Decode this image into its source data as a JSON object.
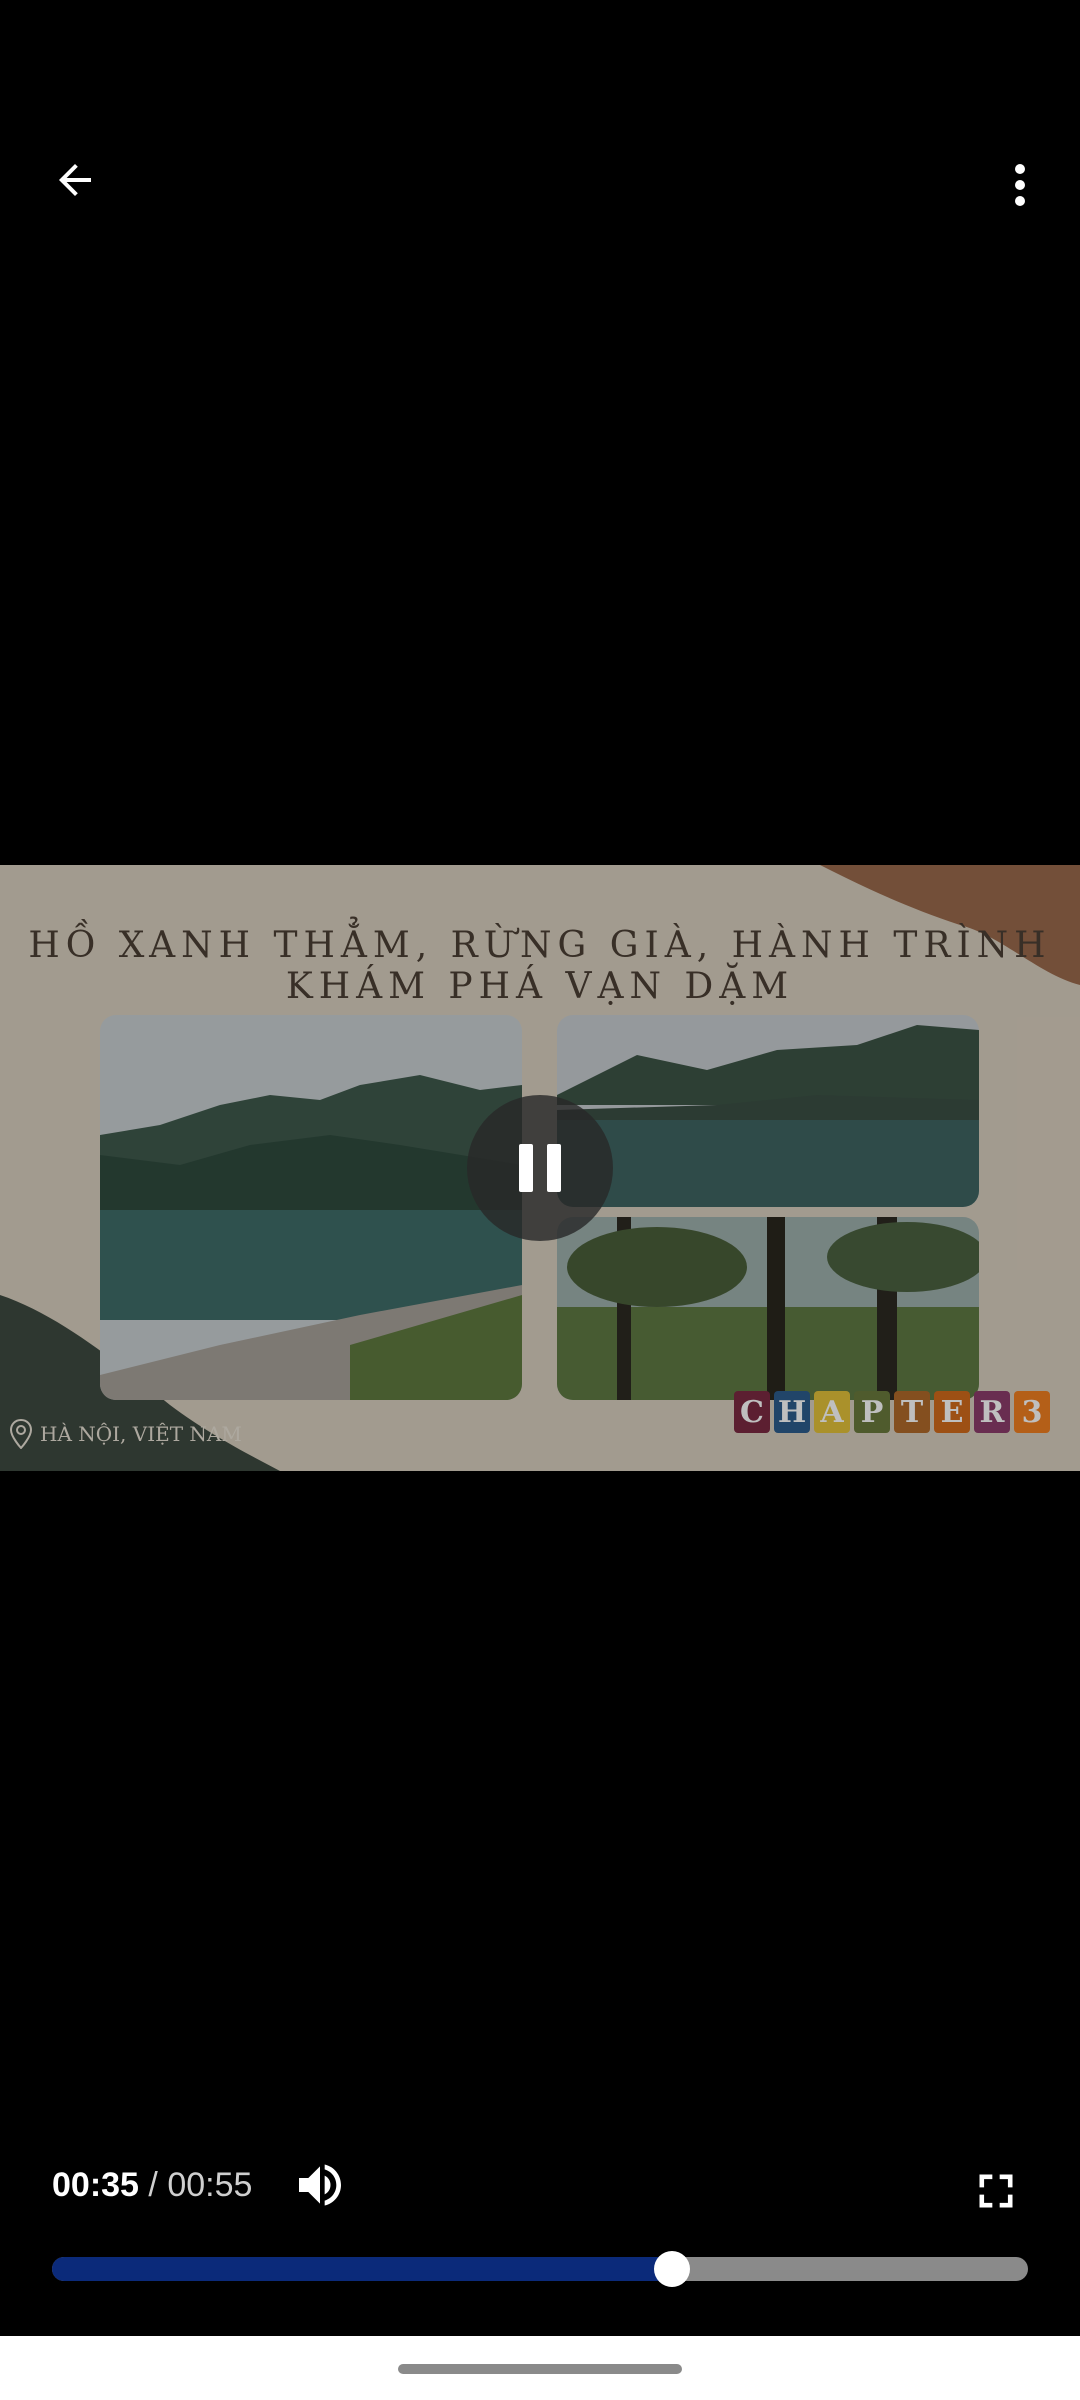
{
  "header": {
    "back_icon": "arrow-left-icon",
    "more_icon": "more-vert-icon"
  },
  "video": {
    "title_overlay": "HỒ XANH THẲM, RỪNG GIÀ, HÀNH TRÌNH KHÁM PHÁ VẠN DẶM",
    "location": "HÀ NỘI, VIỆT NAM",
    "chapter_letters": [
      "C",
      "H",
      "A",
      "P",
      "T",
      "E",
      "R",
      "3"
    ],
    "chapter_colors": [
      "#7b2a42",
      "#2d5d8c",
      "#e3c23a",
      "#6a7a3c",
      "#b06a2a",
      "#d26b1b",
      "#8c3c6b",
      "#f07f20"
    ],
    "state_icon": "pause-icon"
  },
  "player": {
    "current_time": "00:35",
    "separator": "/",
    "duration": "00:55",
    "progress": 0.635,
    "volume_icon": "volume-icon",
    "fullscreen_icon": "fullscreen-icon"
  }
}
